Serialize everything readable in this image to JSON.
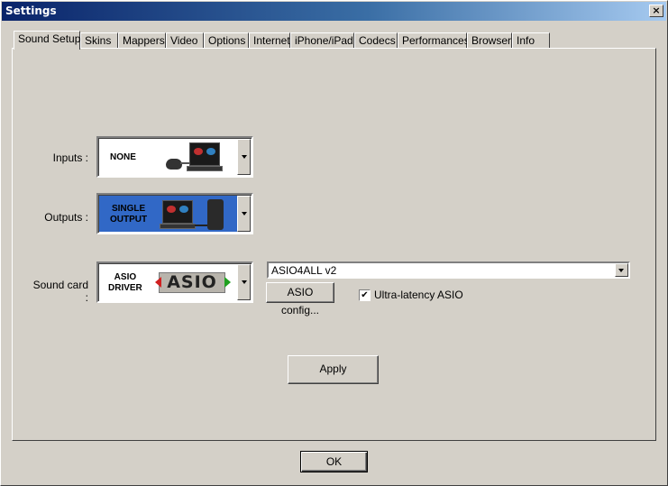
{
  "window": {
    "title": "Settings",
    "close_glyph": "×"
  },
  "tabs": [
    {
      "label": "Sound Setup",
      "active": true
    },
    {
      "label": "Skins"
    },
    {
      "label": "Mappers"
    },
    {
      "label": "Video"
    },
    {
      "label": "Options"
    },
    {
      "label": "Internet"
    },
    {
      "label": "iPhone/iPad"
    },
    {
      "label": "Codecs"
    },
    {
      "label": "Performances"
    },
    {
      "label": "Browser"
    },
    {
      "label": "Info"
    }
  ],
  "sound_setup": {
    "inputs_label": "Inputs :",
    "inputs_value": "NONE",
    "outputs_label": "Outputs :",
    "outputs_value_line1": "SINGLE",
    "outputs_value_line2": "OUTPUT",
    "soundcard_label": "Sound card :",
    "soundcard_value_line1": "ASIO",
    "soundcard_value_line2": "DRIVER",
    "asio_logo_text": "ASIO",
    "driver_select": "ASIO4ALL v2",
    "asio_config_button": "ASIO config...",
    "ultra_latency_label": "Ultra-latency ASIO",
    "ultra_latency_checked": true,
    "apply_button": "Apply"
  },
  "footer": {
    "ok_button": "OK"
  },
  "colors": {
    "titlebar_start": "#0a246a",
    "selection_blue": "#3168c6",
    "dialog_bg": "#d4d0c8"
  }
}
